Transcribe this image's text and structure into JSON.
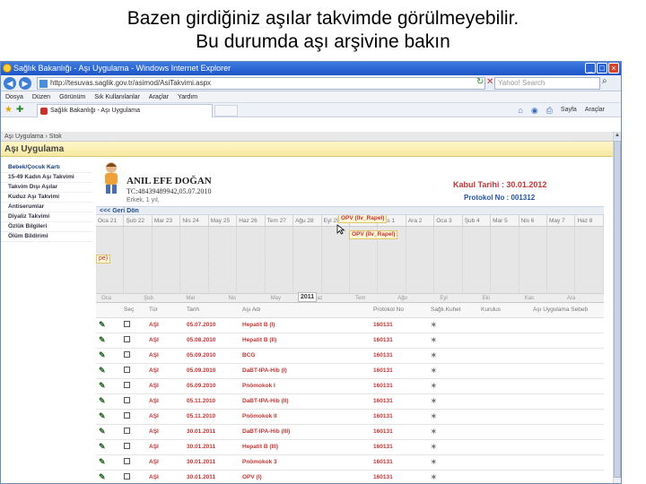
{
  "slide": {
    "title_line1": "Bazen girdiğiniz aşılar takvimde görülmeyebilir.",
    "title_line2": "Bu durumda aşı arşivine bakın"
  },
  "browser": {
    "window_title": "Sağlık Bakanlığı - Aşı Uygulama - Windows Internet Explorer",
    "address": "http://tesuvas.saglik.gov.tr/asimod/AsiTakvimi.aspx",
    "search_placeholder": "Yahoo! Search",
    "menu": [
      "Dosya",
      "Düzen",
      "Görünüm",
      "Sık Kullanılanlar",
      "Araçlar",
      "Yardım"
    ],
    "tab_label": "Sağlık Bakanlığı - Aşı Uygulama",
    "tools": [
      "Sayfa",
      "Araçlar"
    ]
  },
  "app": {
    "breadcrumb": "Aşı Uygulama  ›  Stok",
    "header": "Aşı Uygulama",
    "sidebar": [
      "Bebek/Çocuk Kartı",
      "15-49 Kadın Aşı Takvimi",
      "Takvim Dışı Aşılar",
      "Kuduz Aşı Takvimi",
      "Antiserumlar",
      "Diyaliz Takvimi",
      "Özlük Bilgileri",
      "Ölüm Bildirimi"
    ]
  },
  "patient": {
    "name": "ANIL EFE DOĞAN",
    "tc_line": "TC:48439489942,05.07.2010",
    "age_line": "Erkek, 1 yıl,",
    "kabul": "Kabul Tarihi : 30.01.2012",
    "protokol": "Protokol No : 001312"
  },
  "timeline": {
    "back_label": "<<< Geri Dön",
    "months": [
      "Oca 21",
      "Şub 22",
      "Mar 23",
      "Nis 24",
      "May 25",
      "Haz 26",
      "Tem 27",
      "Ağu 28",
      "Eyl 29",
      "Eki 30",
      "Kas 1",
      "Ara 2",
      "Oca 3",
      "Şub 4",
      "Mar 5",
      "Nis 6",
      "May 7",
      "Haz 8"
    ],
    "events": [
      "OPV (İlv_Rapel)",
      "OPV (İlv_Rapel)"
    ],
    "left_marker": "pe)",
    "bottom_months": [
      "Oca",
      "Şub",
      "Mar",
      "Nis",
      "May",
      "Haz",
      "Tem",
      "Ağu",
      "Eyl",
      "Eki",
      "Kas",
      "Ara"
    ],
    "year": "2011"
  },
  "table": {
    "headers": [
      "",
      "Seç",
      "Tür",
      "Tarih",
      "Aşı Adı",
      "Protokol No",
      "Sağlı.Kuhet",
      "Kurulus",
      "Aşı Uygulama Sebeb"
    ],
    "rows": [
      [
        "AŞI",
        "05.07.2010",
        "Hepatit B (I)",
        "160131"
      ],
      [
        "AŞI",
        "05.08.2010",
        "Hepatit B (II)",
        "160131"
      ],
      [
        "AŞI",
        "05.09.2010",
        "BCG",
        "160131"
      ],
      [
        "AŞI",
        "05.09.2010",
        "DaBT-IPA-Hib (I)",
        "160131"
      ],
      [
        "AŞI",
        "05.09.2010",
        "Pnömokok I",
        "160131"
      ],
      [
        "AŞI",
        "05.11.2010",
        "DaBT-IPA-Hib (II)",
        "160131"
      ],
      [
        "AŞI",
        "05.11.2010",
        "Pnömokok II",
        "160131"
      ],
      [
        "AŞI",
        "30.01.2011",
        "DaBT-IPA-Hib (III)",
        "160131"
      ],
      [
        "AŞI",
        "30.01.2011",
        "Hepatit B (III)",
        "160131"
      ],
      [
        "AŞI",
        "30.01.2011",
        "Pnömokok 3",
        "160131"
      ],
      [
        "AŞI",
        "30.01.2011",
        "OPV (I)",
        "160131"
      ]
    ]
  },
  "colors": {
    "accent_red": "#c23535",
    "link_blue": "#2255a8",
    "header_yellow": "#f7e9a0",
    "titlebar_blue": "#1c55c8"
  }
}
